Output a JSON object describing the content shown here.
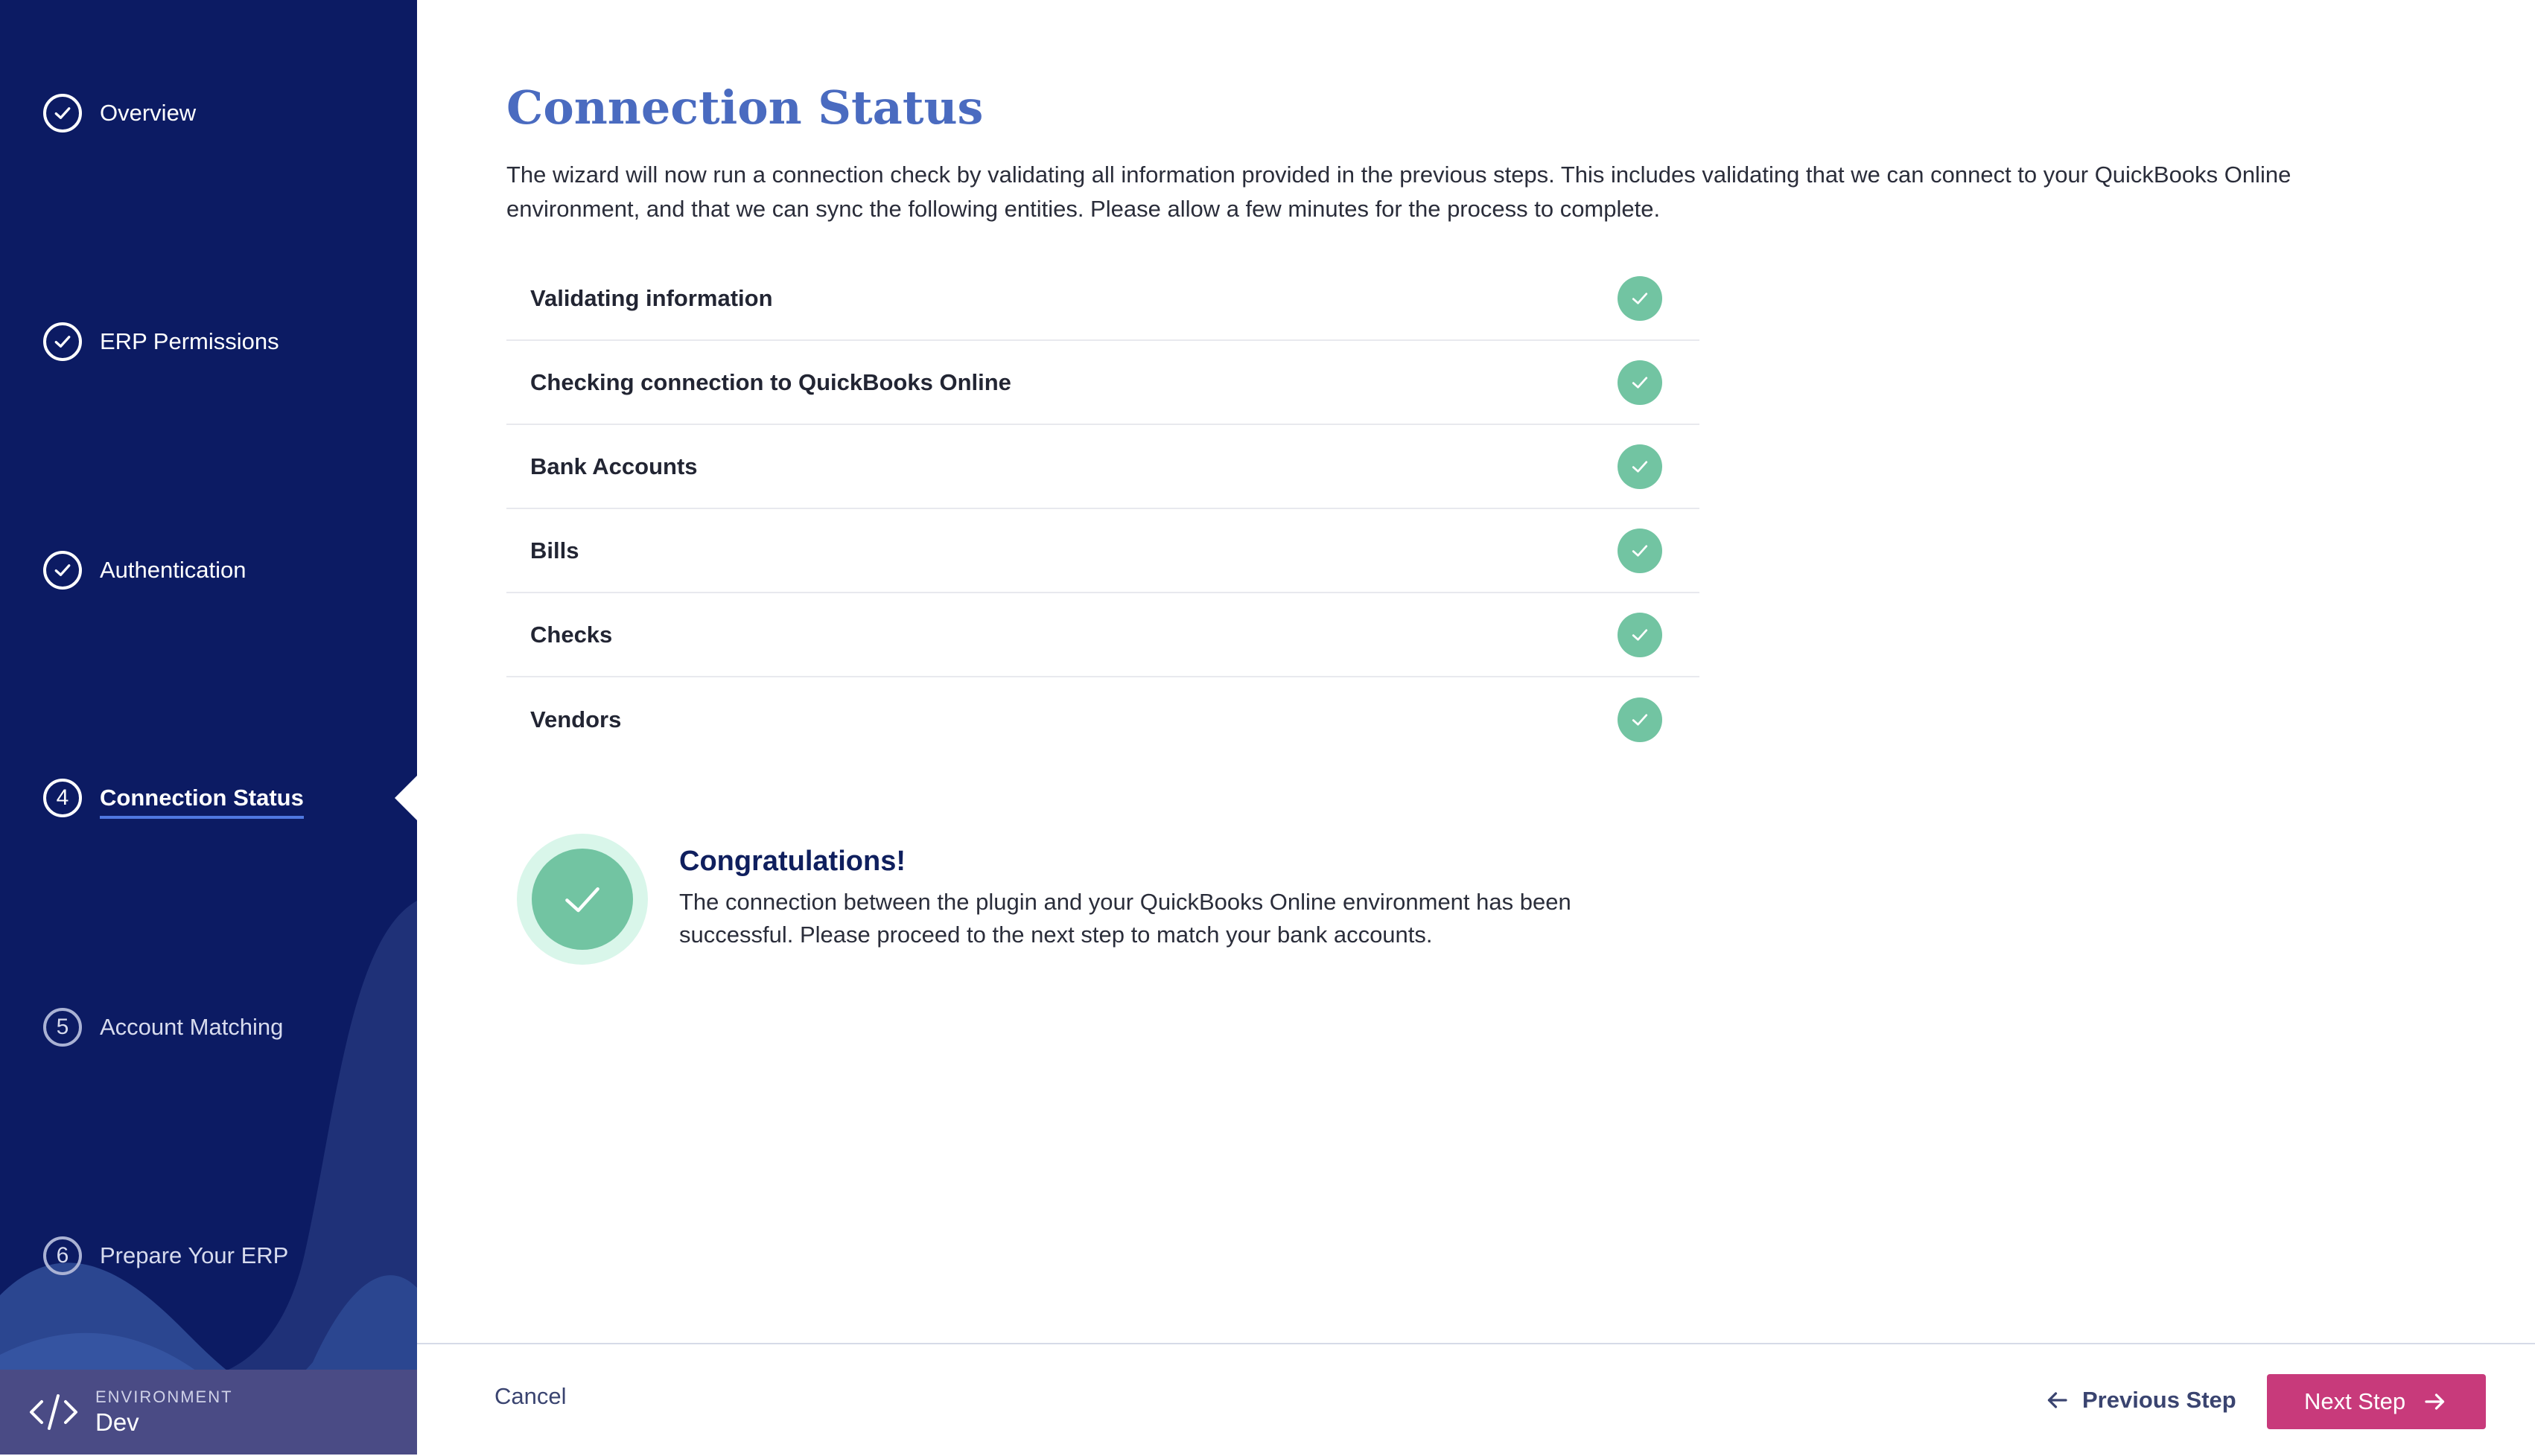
{
  "sidebar": {
    "steps": [
      {
        "label": "Overview",
        "status": "complete",
        "number": ""
      },
      {
        "label": "ERP Permissions",
        "status": "complete",
        "number": ""
      },
      {
        "label": "Authentication",
        "status": "complete",
        "number": ""
      },
      {
        "label": "Connection Status",
        "status": "active",
        "number": "4"
      },
      {
        "label": "Account Matching",
        "status": "pending",
        "number": "5"
      },
      {
        "label": "Prepare Your ERP",
        "status": "pending",
        "number": "6"
      }
    ],
    "environment": {
      "label": "ENVIRONMENT",
      "value": "Dev",
      "icon": "code-icon"
    }
  },
  "main": {
    "title": "Connection Status",
    "description": "The wizard will now run a connection check by validating all information provided in the previous steps. This includes validating that we can connect to your QuickBooks Online environment, and that we can sync the following entities. Please allow a few minutes for the process to complete.",
    "checks": [
      {
        "label": "Validating information",
        "status": "success"
      },
      {
        "label": "Checking connection to QuickBooks Online",
        "status": "success"
      },
      {
        "label": "Bank Accounts",
        "status": "success"
      },
      {
        "label": "Bills",
        "status": "success"
      },
      {
        "label": "Checks",
        "status": "success"
      },
      {
        "label": "Vendors",
        "status": "success"
      }
    ],
    "success": {
      "title": "Congratulations!",
      "text": "The connection between the plugin and your QuickBooks Online environment has been successful. Please proceed to the next step to match your bank accounts."
    }
  },
  "footer": {
    "cancel_label": "Cancel",
    "previous_label": "Previous Step",
    "next_label": "Next Step"
  },
  "colors": {
    "sidebar_bg": "#0c1b63",
    "title": "#4a6bc0",
    "success_green": "#72c4a2",
    "primary_button": "#c83a7b"
  }
}
